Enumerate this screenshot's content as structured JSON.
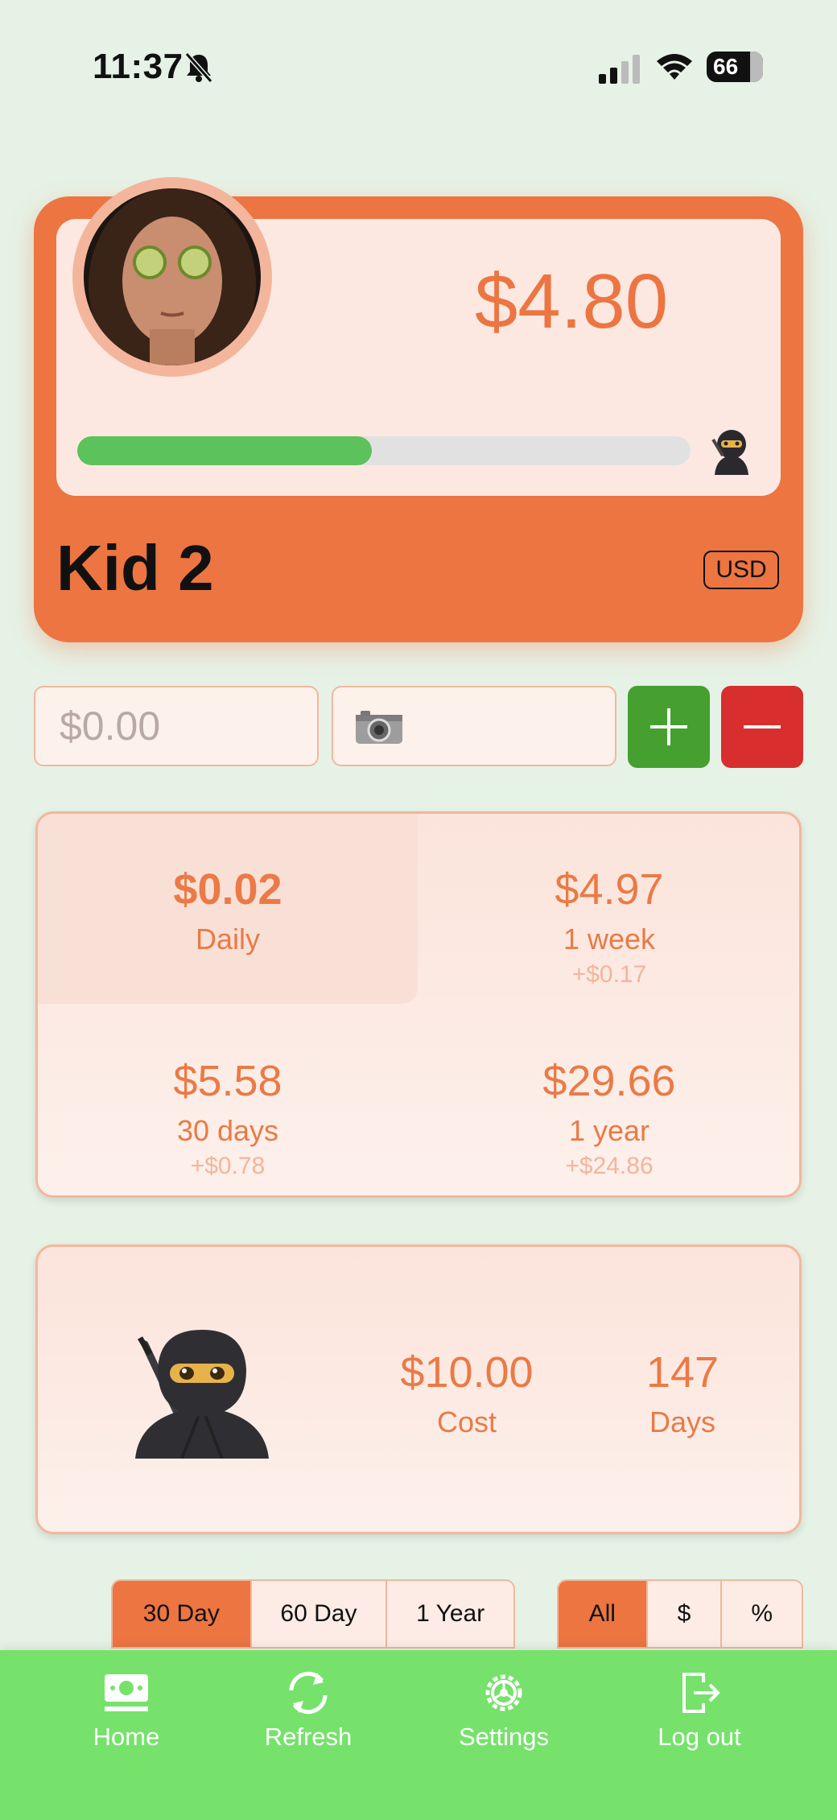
{
  "status_bar": {
    "time": "11:37",
    "battery": "66"
  },
  "profile": {
    "balance": "$4.80",
    "name": "Kid 2",
    "currency": "USD",
    "goal_progress": 0.48
  },
  "entry": {
    "amount_placeholder": "$0.00",
    "camera_icon": "camera-icon",
    "add_icon": "plus-icon",
    "subtract_icon": "minus-icon"
  },
  "stats": [
    {
      "value": "$0.02",
      "label": "Daily",
      "delta": ""
    },
    {
      "value": "$4.97",
      "label": "1 week",
      "delta": "+$0.17"
    },
    {
      "value": "$5.58",
      "label": "30 days",
      "delta": "+$0.78"
    },
    {
      "value": "$29.66",
      "label": "1 year",
      "delta": "+$24.86"
    }
  ],
  "goal": {
    "icon": "ninja-icon",
    "cost_value": "$10.00",
    "cost_label": "Cost",
    "days_value": "147",
    "days_label": "Days"
  },
  "range_tabs": [
    {
      "label": "30 Day",
      "active": true
    },
    {
      "label": "60 Day",
      "active": false
    },
    {
      "label": "1 Year",
      "active": false
    }
  ],
  "mode_tabs": [
    {
      "label": "All",
      "active": true
    },
    {
      "label": "$",
      "active": false
    },
    {
      "label": "%",
      "active": false
    }
  ],
  "nav": [
    {
      "label": "Home",
      "icon": "money-icon"
    },
    {
      "label": "Refresh",
      "icon": "refresh-icon"
    },
    {
      "label": "Settings",
      "icon": "gear-icon"
    },
    {
      "label": "Log out",
      "icon": "logout-icon"
    }
  ],
  "colors": {
    "accent": "#ec7541",
    "background": "#e6f2e6",
    "progress": "#5cc25c",
    "add": "#45a030",
    "subtract": "#d82e2e",
    "nav": "#76e26c"
  }
}
